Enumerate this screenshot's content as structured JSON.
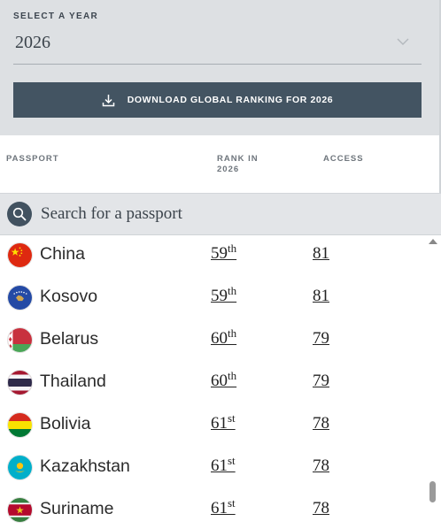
{
  "year_selector": {
    "label": "SELECT A YEAR",
    "value": "2026"
  },
  "download_button": {
    "label": "DOWNLOAD GLOBAL RANKING FOR 2026"
  },
  "columns": {
    "passport": "PASSPORT",
    "rank_line1": "RANK IN",
    "rank_line2": "2026",
    "access": "ACCESS"
  },
  "search": {
    "placeholder": "Search for a passport"
  },
  "rows": [
    {
      "country": "China",
      "rank": "59",
      "suffix": "th",
      "access": "81",
      "flag": "china-flag-icon"
    },
    {
      "country": "Kosovo",
      "rank": "59",
      "suffix": "th",
      "access": "81",
      "flag": "kosovo-flag-icon"
    },
    {
      "country": "Belarus",
      "rank": "60",
      "suffix": "th",
      "access": "79",
      "flag": "belarus-flag-icon"
    },
    {
      "country": "Thailand",
      "rank": "60",
      "suffix": "th",
      "access": "79",
      "flag": "thailand-flag-icon"
    },
    {
      "country": "Bolivia",
      "rank": "61",
      "suffix": "st",
      "access": "78",
      "flag": "bolivia-flag-icon"
    },
    {
      "country": "Kazakhstan",
      "rank": "61",
      "suffix": "st",
      "access": "78",
      "flag": "kazakhstan-flag-icon"
    },
    {
      "country": "Suriname",
      "rank": "61",
      "suffix": "st",
      "access": "78",
      "flag": "suriname-flag-icon"
    }
  ],
  "colors": {
    "panel_bg": "#dde0e3",
    "button_bg": "#435462",
    "search_bg": "#e3e5e8"
  }
}
